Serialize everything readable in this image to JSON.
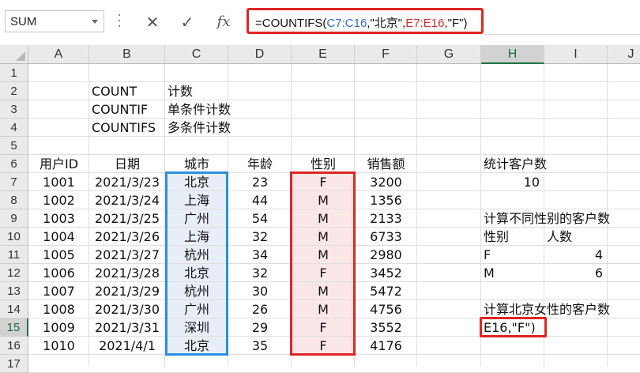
{
  "formula_bar": {
    "name_box": "SUM",
    "cancel_icon": "✕",
    "enter_icon": "✓",
    "fx_label": "fx",
    "formula_parts": [
      {
        "text": "=COUNTIFS(",
        "color": "#111111"
      },
      {
        "text": "C7:C16",
        "color": "#2b6fd6"
      },
      {
        "text": ",\"北京\",",
        "color": "#111111"
      },
      {
        "text": "E7:E16",
        "color": "#d42a2a"
      },
      {
        "text": ",\"F\")",
        "color": "#111111"
      }
    ]
  },
  "columns": [
    "A",
    "B",
    "C",
    "D",
    "E",
    "F",
    "G",
    "H",
    "I",
    "J"
  ],
  "rows": [
    "1",
    "2",
    "3",
    "4",
    "5",
    "6",
    "7",
    "8",
    "9",
    "10",
    "11",
    "12",
    "13",
    "14",
    "15",
    "16",
    "17"
  ],
  "selected_column": "H",
  "selected_row": "15",
  "notes": [
    {
      "func": "COUNT",
      "desc": "计数"
    },
    {
      "func": "COUNTIF",
      "desc": "单条件计数"
    },
    {
      "func": "COUNTIFS",
      "desc": "多条件计数"
    }
  ],
  "table": {
    "headers": [
      "用户ID",
      "日期",
      "城市",
      "年龄",
      "性别",
      "销售额"
    ],
    "rows": [
      [
        "1001",
        "2021/3/23",
        "北京",
        "23",
        "F",
        "3200"
      ],
      [
        "1002",
        "2021/3/24",
        "上海",
        "44",
        "M",
        "1356"
      ],
      [
        "1003",
        "2021/3/25",
        "广州",
        "54",
        "M",
        "2133"
      ],
      [
        "1004",
        "2021/3/26",
        "上海",
        "32",
        "M",
        "6733"
      ],
      [
        "1005",
        "2021/3/27",
        "杭州",
        "34",
        "M",
        "2980"
      ],
      [
        "1006",
        "2021/3/28",
        "北京",
        "32",
        "F",
        "3452"
      ],
      [
        "1007",
        "2021/3/29",
        "杭州",
        "30",
        "M",
        "5472"
      ],
      [
        "1008",
        "2021/3/30",
        "广州",
        "26",
        "M",
        "4756"
      ],
      [
        "1009",
        "2021/3/31",
        "深圳",
        "29",
        "F",
        "3552"
      ],
      [
        "1010",
        "2021/4/1",
        "北京",
        "35",
        "F",
        "4176"
      ]
    ]
  },
  "summary": {
    "count_title": "统计客户数",
    "count_value": "10",
    "gender_title": "计算不同性别的客户数",
    "gender_header": "性别",
    "count_header": "人数",
    "gender_rows": [
      {
        "gender": "F",
        "count": "4"
      },
      {
        "gender": "M",
        "count": "6"
      }
    ],
    "bj_female_title": "计算北京女性的客户数",
    "editing_cell_text": "E16,\"F\")"
  },
  "accent_colors": {
    "blue_range": "#2b8fe0",
    "red_range": "#e02424",
    "excel_green": "#217346"
  }
}
